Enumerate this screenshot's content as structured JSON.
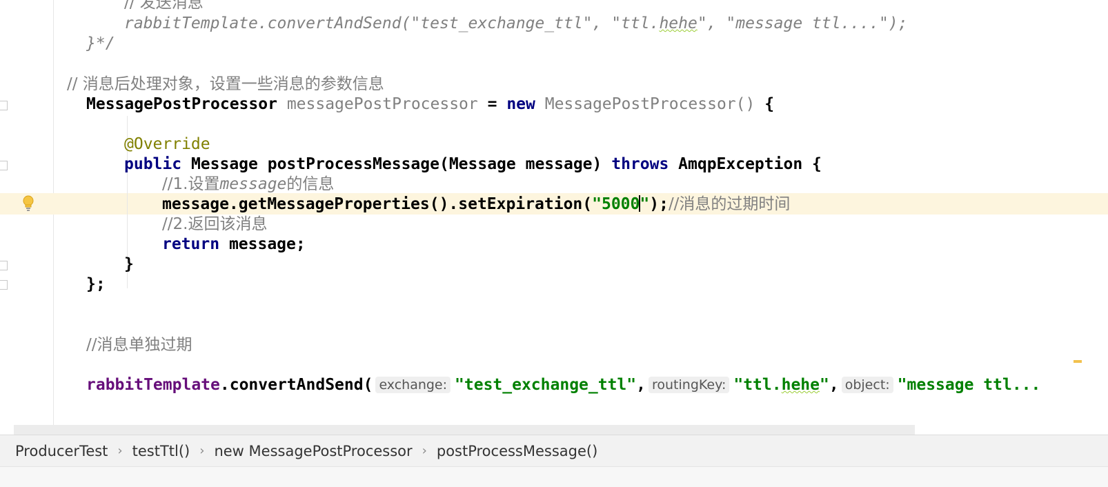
{
  "code": {
    "l0_comment": "// 发送消息",
    "l1_a": "rabbitTemplate.convertAndSend(\"test_exchange_ttl\", \"ttl.",
    "l1_hehe": "hehe",
    "l1_b": "\", \"message ttl....\");",
    "l2": "}*/",
    "l3_comment": "// 消息后处理对象，设置一些消息的参数信息",
    "l4_type": "MessagePostProcessor",
    "l4_var": "messagePostProcessor",
    "l4_eq": " = ",
    "l4_new": "new",
    "l4_class": "MessagePostProcessor()",
    "l4_brace": " {",
    "l5_annotation": "@Override",
    "l6_public": "public",
    "l6_sig": " Message postProcessMessage(Message message) ",
    "l6_throws": "throws",
    "l6_rest": " AmqpException {",
    "l7_a": "//1.设置",
    "l7_b": "message",
    "l7_c": "的信息",
    "l8_a": "message.getMessageProperties().setExpiration(",
    "l8_str_a": "\"5000",
    "l8_str_b": "\"",
    "l8_b": ");",
    "l8_comment": "//消息的过期时间",
    "l9_comment": "//2.返回该消息",
    "l10_return": "return",
    "l10_rest": " message;",
    "l11": "}",
    "l12": "};",
    "l13_comment": "//消息单独过期",
    "l14_obj": "rabbitTemplate",
    "l14_call": ".convertAndSend(",
    "hint_exchange": "exchange:",
    "l14_s1": "\"test_exchange_ttl\"",
    "l14_comma1": ",",
    "hint_routing": "routingKey:",
    "l14_s2a": "\"ttl.",
    "l14_s2b": "hehe",
    "l14_s2c": "\"",
    "l14_comma2": ",",
    "hint_object": "object:",
    "l14_s3": "\"message ttl..."
  },
  "breadcrumb": {
    "items": [
      "ProducerTest",
      "testTtl()",
      "new MessagePostProcessor",
      "postProcessMessage()"
    ]
  },
  "icons": {
    "intention": "lightbulb-icon",
    "separator": "chevron-right-icon",
    "fold": "fold-marker-icon"
  },
  "colors": {
    "keyword": "#000080",
    "string": "#008000",
    "comment": "#808080",
    "annotation": "#808000",
    "current_line": "#fdf5de"
  }
}
